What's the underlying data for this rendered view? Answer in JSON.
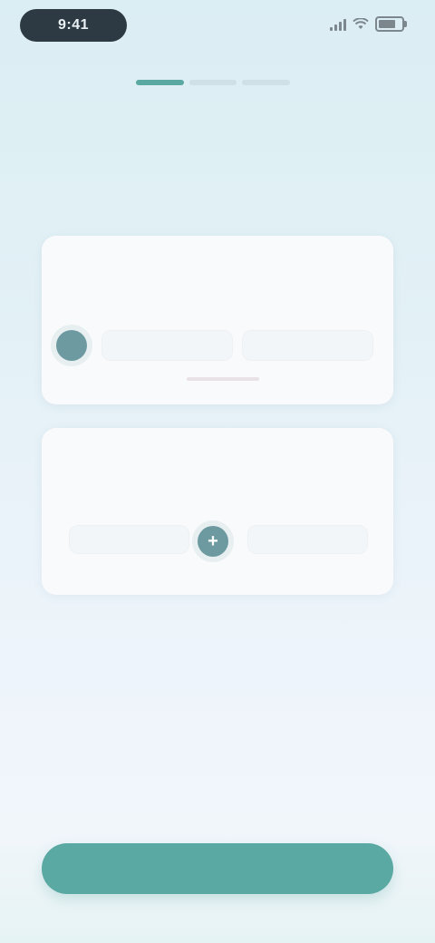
{
  "status_bar": {
    "time": "9:41",
    "signal_icon": "signal-bars-icon",
    "wifi_icon": "wifi-icon",
    "battery_icon": "battery-icon"
  },
  "progress": {
    "total_steps": 3,
    "current_step": 1
  },
  "header": {
    "title": "",
    "subtitle": ""
  },
  "cards": [
    {
      "title": "",
      "description": ""
    },
    {
      "title": "",
      "description": "",
      "button_icon": "plus-icon"
    }
  ],
  "cta": {
    "label": ""
  },
  "colors": {
    "accent": "#5ba9a3",
    "avatar": "#6d9aa1",
    "status_pill": "#2d3a43",
    "title_text": "#3e4d57"
  }
}
